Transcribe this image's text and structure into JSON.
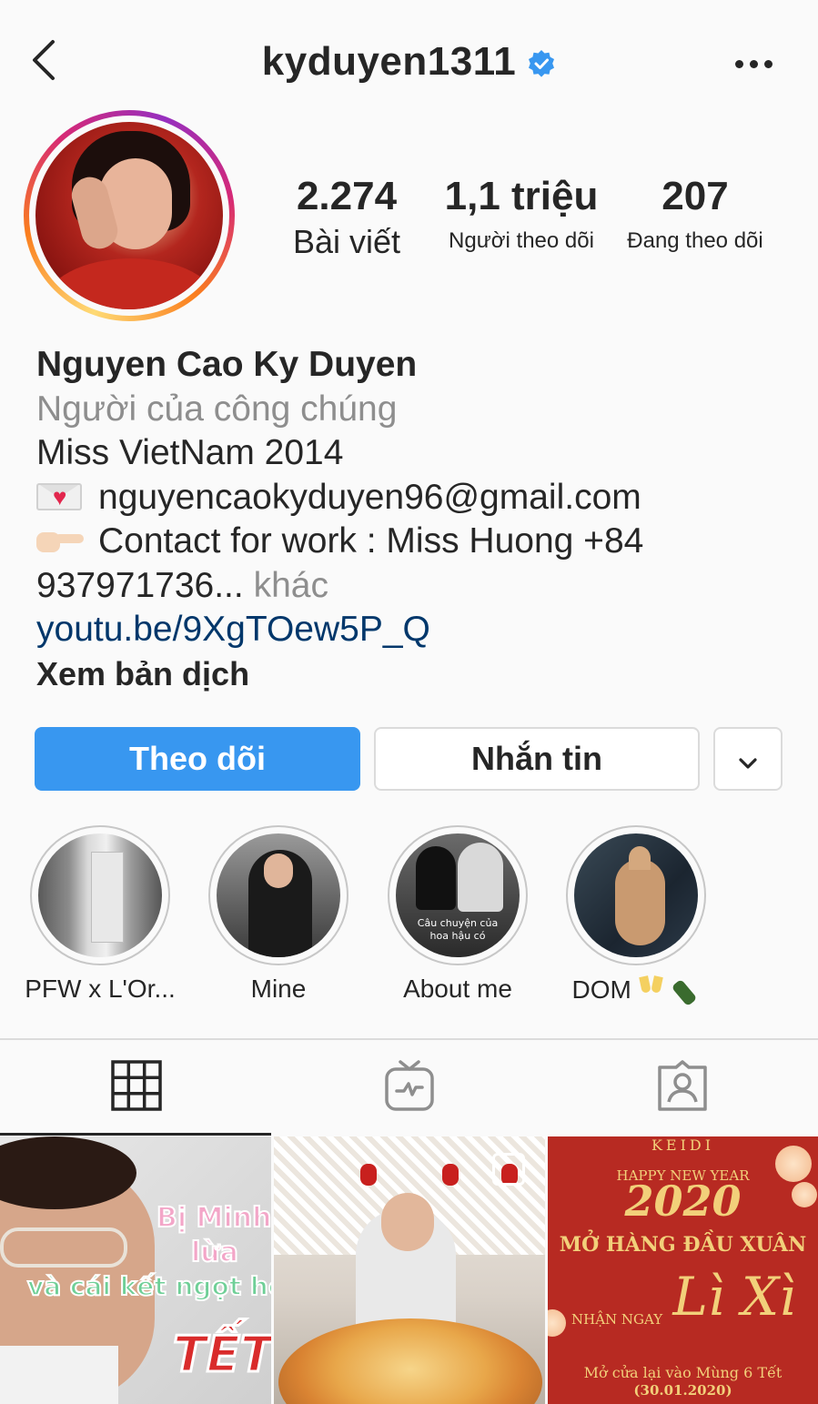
{
  "header": {
    "username": "kyduyen1311",
    "verified": true,
    "back_icon": "chevron-left-icon",
    "more_icon": "more-horizontal-icon"
  },
  "stats": {
    "posts_count": "2.274",
    "posts_label": "Bài viết",
    "followers_count": "1,1 triệu",
    "followers_label": "Người theo dõi",
    "following_count": "207",
    "following_label": "Đang theo dõi"
  },
  "bio": {
    "name": "Nguyen Cao Ky Duyen",
    "category": "Người của công chúng",
    "line1": "Miss VietNam 2014",
    "email": "nguyencaokyduyen96@gmail.com",
    "contact": "Contact for work : Miss Huong +84",
    "phone_rest": "937971736...",
    "more_label": "khác",
    "link": "youtu.be/9XgTOew5P_Q",
    "translate_label": "Xem bản dịch"
  },
  "actions": {
    "follow_label": "Theo dõi",
    "message_label": "Nhắn tin",
    "dropdown_icon": "chevron-down-icon",
    "follow_color": "#3897f0"
  },
  "highlights": [
    {
      "label": "PFW x L'Or..."
    },
    {
      "label": "Mine"
    },
    {
      "label": "About me",
      "caption_line1": "Câu chuyện của",
      "caption_line2": "hoa hậu có"
    },
    {
      "label": "DOM"
    }
  ],
  "tabs": [
    {
      "icon": "grid-icon",
      "active": true
    },
    {
      "icon": "igtv-icon",
      "active": false
    },
    {
      "icon": "tagged-icon",
      "active": false
    }
  ],
  "posts": {
    "post1": {
      "line1": "Bị Minh T",
      "line2": "lừa",
      "line3": "và cái kết ngọt hơ",
      "line4": "TẾT"
    },
    "post3": {
      "brand": "KEIDI",
      "greeting": "HAPPY NEW YEAR",
      "year": "2020",
      "headline": "MỞ HÀNG ĐẦU XUÂN",
      "sub": "NHẬN NGAY",
      "script": "Lì Xì",
      "footer": "Mở cửa lại vào Mùng 6 Tết",
      "date": "(30.01.2020)"
    }
  },
  "colors": {
    "link": "#00376b",
    "secondary_text": "#8e8e8e",
    "primary_text": "#262626"
  }
}
